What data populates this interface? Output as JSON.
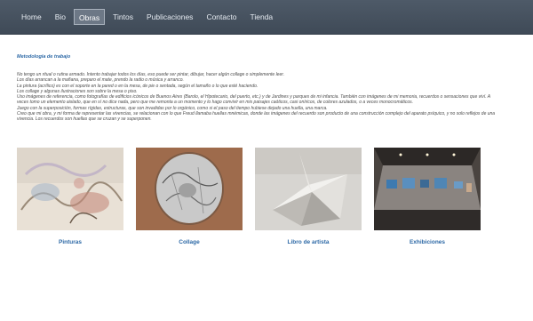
{
  "nav": {
    "items": [
      {
        "label": "Home",
        "active": false
      },
      {
        "label": "Bio",
        "active": false
      },
      {
        "label": "Obras",
        "active": true
      },
      {
        "label": "Tintos",
        "active": false
      },
      {
        "label": "Publicaciones",
        "active": false
      },
      {
        "label": "Contacto",
        "active": false
      },
      {
        "label": "Tienda",
        "active": false
      }
    ]
  },
  "main": {
    "title": "Metodología de trabajo",
    "paragraphs": [
      "No tengo un ritual o rutina armado. Intento trabajar todos los días, eso puede ser pintar, dibujar, hacer algún collage o simplemente leer.",
      "Los días arrancan a la mañana, preparo el mate, prendo la radio o música y arranco.",
      "La pintura (acrílico) es con el soporte en la pared o en la mesa, de pie o sentada, según el tamaño o lo que esté haciendo.",
      "Los collage y algunas ilustraciones son sobre la mesa o piso.",
      "Uso imágenes de referencia, como fotografías de edificios icónicos de Buenos Aires (Barolo, el Hipotecario, del puerto, etc.) y de Jardines y parques de mi infancia. También con imágenes de mi memoria, recuerdos o sensaciones que viví. A veces tomo un elemento aislado, que en sí no dice nada, pero que me remonta a un momento y lo hago convivir en mis paisajes caóticos, casi oníricos, de colores azulados, o a veces monocromáticos.",
      "Juego con la superposición, formas rígidas, estructuras, que son invadidas por lo orgánico, como si el paso del tiempo hubiese dejado una huella, una marca.",
      "Creo que mi obra, y mi forma de representar las vivencias, se relacionan con lo que Freud llamaba huellas mnémicas, donde las imágenes del recuerdo son producto de una construcción complejo del aparato psíquico, y no solo reflejos de una vivencia. Los recuerdos son huellas que se cruzan y se superponen."
    ]
  },
  "gallery": [
    {
      "caption": "Pinturas",
      "image": "painting-thumbnail"
    },
    {
      "caption": "Collage",
      "image": "circular-collage-thumbnail"
    },
    {
      "caption": "Libro de artista",
      "image": "folded-paper-sculpture-thumbnail"
    },
    {
      "caption": "Exhibiciones",
      "image": "gallery-exhibition-thumbnail"
    }
  ]
}
